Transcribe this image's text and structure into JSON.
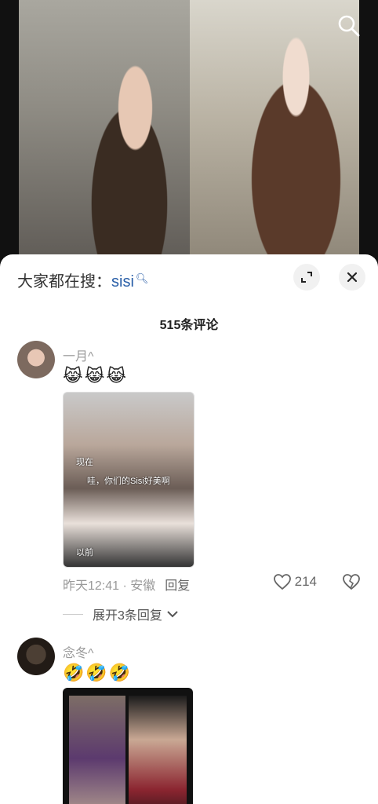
{
  "hot_search": {
    "prefix": "大家都在搜：",
    "keyword": "sisi"
  },
  "comments_title": "515条评论",
  "comments": [
    {
      "username": "一月^",
      "emojis": "😹😹😹",
      "image_captions": [
        "现在",
        "哇，你们的Sisi好美啊",
        "以前"
      ],
      "time_location": "昨天12:41 · 安徽",
      "reply_label": "回复",
      "likes": "214",
      "expand_replies_label": "展开3条回复"
    },
    {
      "username": "念冬^",
      "emojis": "🤣🤣🤣"
    }
  ],
  "icons": {
    "search": "search-icon",
    "expand": "expand-icon",
    "close": "close-icon",
    "heart": "heart-icon",
    "broken_heart": "dislike-icon",
    "chevron": "chevron-down-icon"
  },
  "colors": {
    "keyword": "#2a5fa8",
    "muted": "#9a9a9a"
  }
}
